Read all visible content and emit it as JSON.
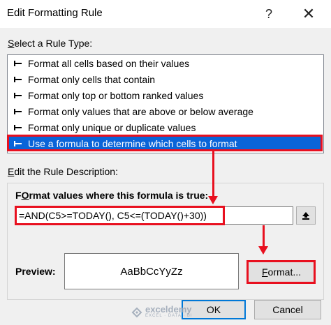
{
  "window": {
    "title": "Edit Formatting Rule",
    "help_glyph": "?",
    "close_glyph": "✕"
  },
  "rule_type": {
    "label_prefix": "",
    "label_accel": "S",
    "label_rest": "elect a Rule Type:",
    "items": [
      {
        "label": "Format all cells based on their values"
      },
      {
        "label": "Format only cells that contain"
      },
      {
        "label": "Format only top or bottom ranked values"
      },
      {
        "label": "Format only values that are above or below average"
      },
      {
        "label": "Format only unique or duplicate values"
      },
      {
        "label": "Use a formula to determine which cells to format"
      }
    ],
    "selected_index": 5
  },
  "description": {
    "label_prefix": "",
    "label_accel": "E",
    "label_rest": "dit the Rule Description:",
    "heading_accel": "O",
    "heading_before": "F",
    "heading_after": "rmat values where this formula is true:",
    "formula_value": "=AND(C5>=TODAY(), C5<=(TODAY()+30))",
    "preview_label": "Preview:",
    "preview_text": "AaBbCcYyZz",
    "format_button_accel": "F",
    "format_button_rest": "ormat..."
  },
  "footer": {
    "ok_label": "OK",
    "cancel_label": "Cancel"
  },
  "watermark": {
    "name": "exceldemy",
    "tagline": "EXCEL · DATA · BI"
  },
  "colors": {
    "selection": "#0a64d8",
    "highlight": "#e8101f",
    "default_button_border": "#0078d7"
  }
}
